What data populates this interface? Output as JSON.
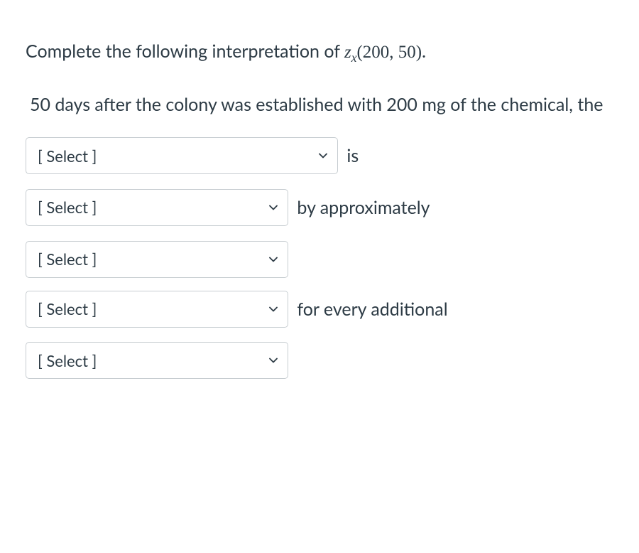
{
  "prompt": {
    "pre": "Complete the following interpretation of ",
    "func_var": "z",
    "func_sub": "x",
    "func_args": "(200, 50)",
    "post": "."
  },
  "sentence": {
    "intro": "50 days after the colony was established with 200 mg of the chemical, the",
    "after1": "is",
    "after2": "by approximately",
    "after4": "for every additional"
  },
  "select_placeholder": "[ Select ]"
}
